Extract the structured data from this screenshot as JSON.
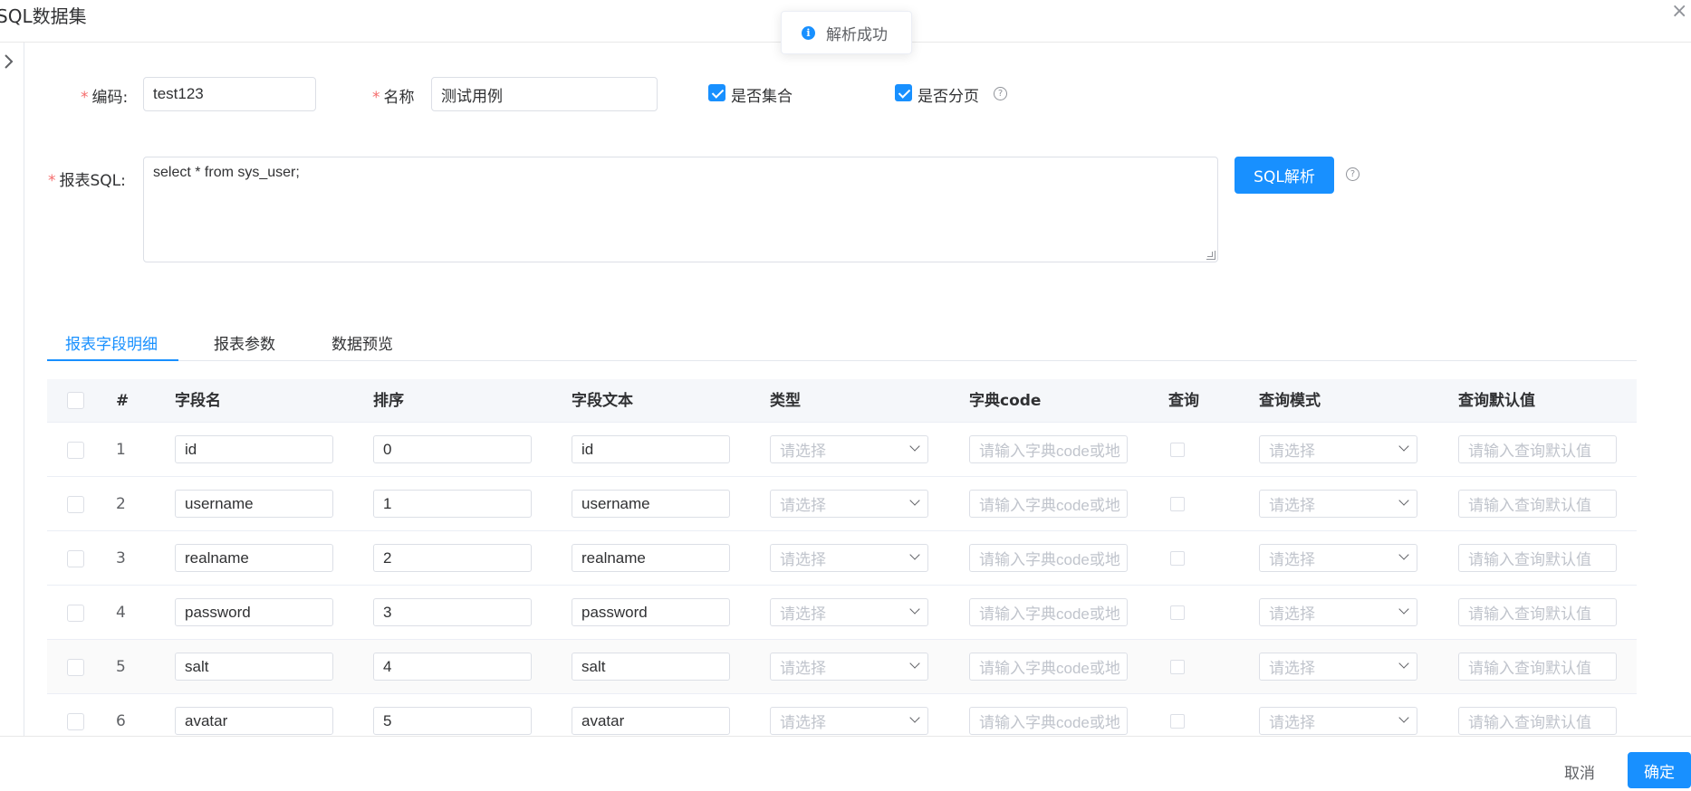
{
  "dialog": {
    "title": "SQL数据集",
    "close_glyph": "×"
  },
  "toast": {
    "message": "解析成功",
    "icon": "info-icon"
  },
  "form": {
    "code_label": "编码:",
    "code_value": "test123",
    "name_label": "名称",
    "name_value": "测试用例",
    "is_collection_label": "是否集合",
    "is_collection_checked": true,
    "is_paged_label": "是否分页",
    "is_paged_checked": true,
    "sql_label": "报表SQL:",
    "sql_value": "select * from sys_user;",
    "parse_button": "SQL解析",
    "required_mark": "*",
    "help_glyph": "?"
  },
  "tabs": [
    {
      "label": "报表字段明细",
      "active": true
    },
    {
      "label": "报表参数",
      "active": false
    },
    {
      "label": "数据预览",
      "active": false
    }
  ],
  "table": {
    "headers": {
      "index": "#",
      "field_name": "字段名",
      "order": "排序",
      "field_text": "字段文本",
      "type": "类型",
      "dict_code": "字典code",
      "query": "查询",
      "query_mode": "查询模式",
      "query_default": "查询默认值"
    },
    "placeholders": {
      "type": "请选择",
      "dict_code": "请输入字典code或地",
      "query_mode": "请选择",
      "query_default": "请输入查询默认值"
    },
    "rows": [
      {
        "index": "1",
        "field_name": "id",
        "order": "0",
        "field_text": "id"
      },
      {
        "index": "2",
        "field_name": "username",
        "order": "1",
        "field_text": "username"
      },
      {
        "index": "3",
        "field_name": "realname",
        "order": "2",
        "field_text": "realname"
      },
      {
        "index": "4",
        "field_name": "password",
        "order": "3",
        "field_text": "password"
      },
      {
        "index": "5",
        "field_name": "salt",
        "order": "4",
        "field_text": "salt"
      },
      {
        "index": "6",
        "field_name": "avatar",
        "order": "5",
        "field_text": "avatar"
      }
    ]
  },
  "footer": {
    "cancel_label": "取消",
    "confirm_label": "确定"
  },
  "colors": {
    "primary": "#1890ff",
    "required": "#f56c6c"
  }
}
